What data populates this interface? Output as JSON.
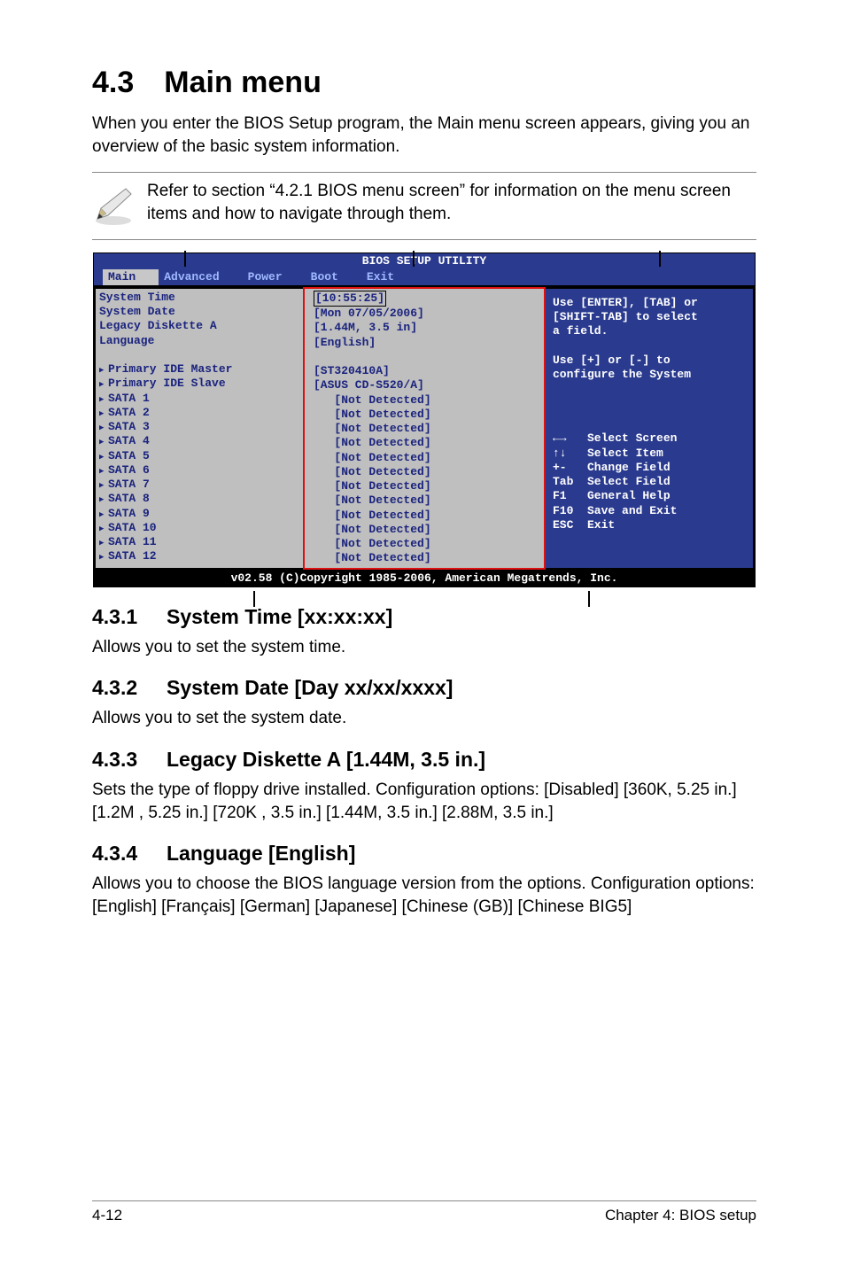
{
  "titles": {
    "main": "4.3 Main menu",
    "intro": "When you enter the BIOS Setup program, the Main menu screen appears, giving you an overview of the basic system information.",
    "note": "Refer to section “4.2.1  BIOS menu screen” for information on the menu screen items and how to navigate through them."
  },
  "bios": {
    "header": "BIOS SETUP UTILITY",
    "menu": [
      "Main",
      "Advanced",
      "Power",
      "Boot",
      "Exit"
    ],
    "selected_menu_index": 0,
    "left_top": [
      "System Time",
      "System Date",
      "Legacy Diskette A",
      "Language"
    ],
    "left_devices": [
      "Primary IDE Master",
      "Primary IDE Slave",
      "SATA 1",
      "SATA 2",
      "SATA 3",
      "SATA 4",
      "SATA 5",
      "SATA 6",
      "SATA 7",
      "SATA 8",
      "SATA 9",
      "SATA 10",
      "SATA 11",
      "SATA 12"
    ],
    "mid_top": {
      "time": "[10:55:25]",
      "rows": [
        "[Mon 07/05/2006]",
        "[1.44M, 3.5 in]",
        "[English]"
      ]
    },
    "mid_devices": [
      "[ST320410A]",
      "[ASUS CD-S520/A]",
      "[Not Detected]",
      "[Not Detected]",
      "[Not Detected]",
      "[Not Detected]",
      "[Not Detected]",
      "[Not Detected]",
      "[Not Detected]",
      "[Not Detected]",
      "[Not Detected]",
      "[Not Detected]",
      "[Not Detected]",
      "[Not Detected]"
    ],
    "help_top": [
      "Use [ENTER], [TAB] or",
      "[SHIFT-TAB] to select",
      "a field."
    ],
    "help_mid": [
      "Use [+] or [-] to",
      "configure the System"
    ],
    "help_nav": [
      "←→   Select Screen",
      "↑↓   Select Item",
      "+-   Change Field",
      "Tab  Select Field",
      "F1   General Help",
      "F10  Save and Exit",
      "ESC  Exit"
    ],
    "footer": "v02.58 (C)Copyright 1985-2006, American Megatrends, Inc."
  },
  "sections": {
    "s1": {
      "num": "4.3.1",
      "title": "System Time [xx:xx:xx]",
      "body": "Allows you to set the system time."
    },
    "s2": {
      "num": "4.3.2",
      "title": "System Date [Day xx/xx/xxxx]",
      "body": "Allows you to set the system date."
    },
    "s3": {
      "num": "4.3.3",
      "title": "Legacy Diskette A [1.44M, 3.5 in.]",
      "body": "Sets the type of floppy drive installed. Configuration options: [Disabled] [360K, 5.25 in.] [1.2M , 5.25 in.] [720K , 3.5 in.] [1.44M, 3.5 in.] [2.88M, 3.5 in.]"
    },
    "s4": {
      "num": "4.3.4",
      "title": "Language [English]",
      "body": "Allows you to choose the BIOS language version from the options. Configuration options: [English] [Français] [German] [Japanese] [Chinese (GB)] [Chinese BIG5]"
    }
  },
  "footer": {
    "left": "4-12",
    "right": "Chapter 4: BIOS setup"
  }
}
